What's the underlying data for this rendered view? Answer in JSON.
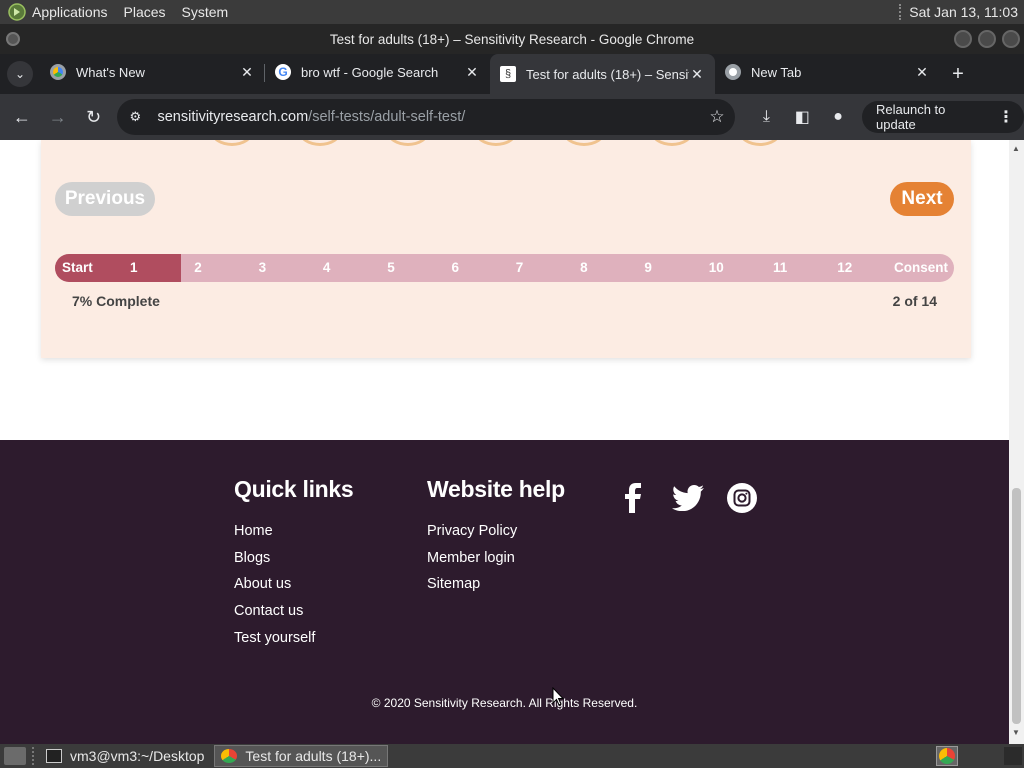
{
  "os": {
    "menu": [
      "Applications",
      "Places",
      "System"
    ],
    "clock": "Sat Jan 13, 11:03"
  },
  "window": {
    "title": "Test for adults (18+) – Sensitivity Research - Google Chrome"
  },
  "tabs": [
    {
      "label": "What's New",
      "active": false
    },
    {
      "label": "bro wtf - Google Search",
      "active": false
    },
    {
      "label": "Test for adults (18+) – Sensitivity Research",
      "active": true
    },
    {
      "label": "New Tab",
      "active": false
    }
  ],
  "toolbar": {
    "url_host": "sensitivityresearch.com",
    "url_path": "/self-tests/adult-self-test/",
    "relaunch_label": "Relaunch to update"
  },
  "test": {
    "prev_label": "Previous",
    "next_label": "Next",
    "progress_fraction": 0.14,
    "steps": [
      "Start",
      "1",
      "2",
      "3",
      "4",
      "5",
      "6",
      "7",
      "8",
      "9",
      "10",
      "11",
      "12",
      "Consent"
    ],
    "percent_label": "7% Complete",
    "count_label": "2 of 14"
  },
  "footer": {
    "quick_links_title": "Quick links",
    "quick_links": [
      "Home",
      "Blogs",
      "About us",
      "Contact us",
      "Test yourself"
    ],
    "help_title": "Website help",
    "help_links": [
      "Privacy Policy",
      "Member login",
      "Sitemap"
    ],
    "social": [
      "facebook-icon",
      "twitter-icon",
      "instagram-icon"
    ],
    "copyright": "© 2020 Sensitivity Research. All Rights Reserved."
  },
  "taskbar": {
    "tasks": [
      "vm3@vm3:~/Desktop",
      "Test for adults (18+)..."
    ]
  },
  "colors": {
    "next_button": "#e58234",
    "progress_fill": "#b04d5f",
    "progress_track": "#dfb1bd",
    "card_bg": "#fcece3",
    "footer_bg": "#2d1b2d"
  }
}
